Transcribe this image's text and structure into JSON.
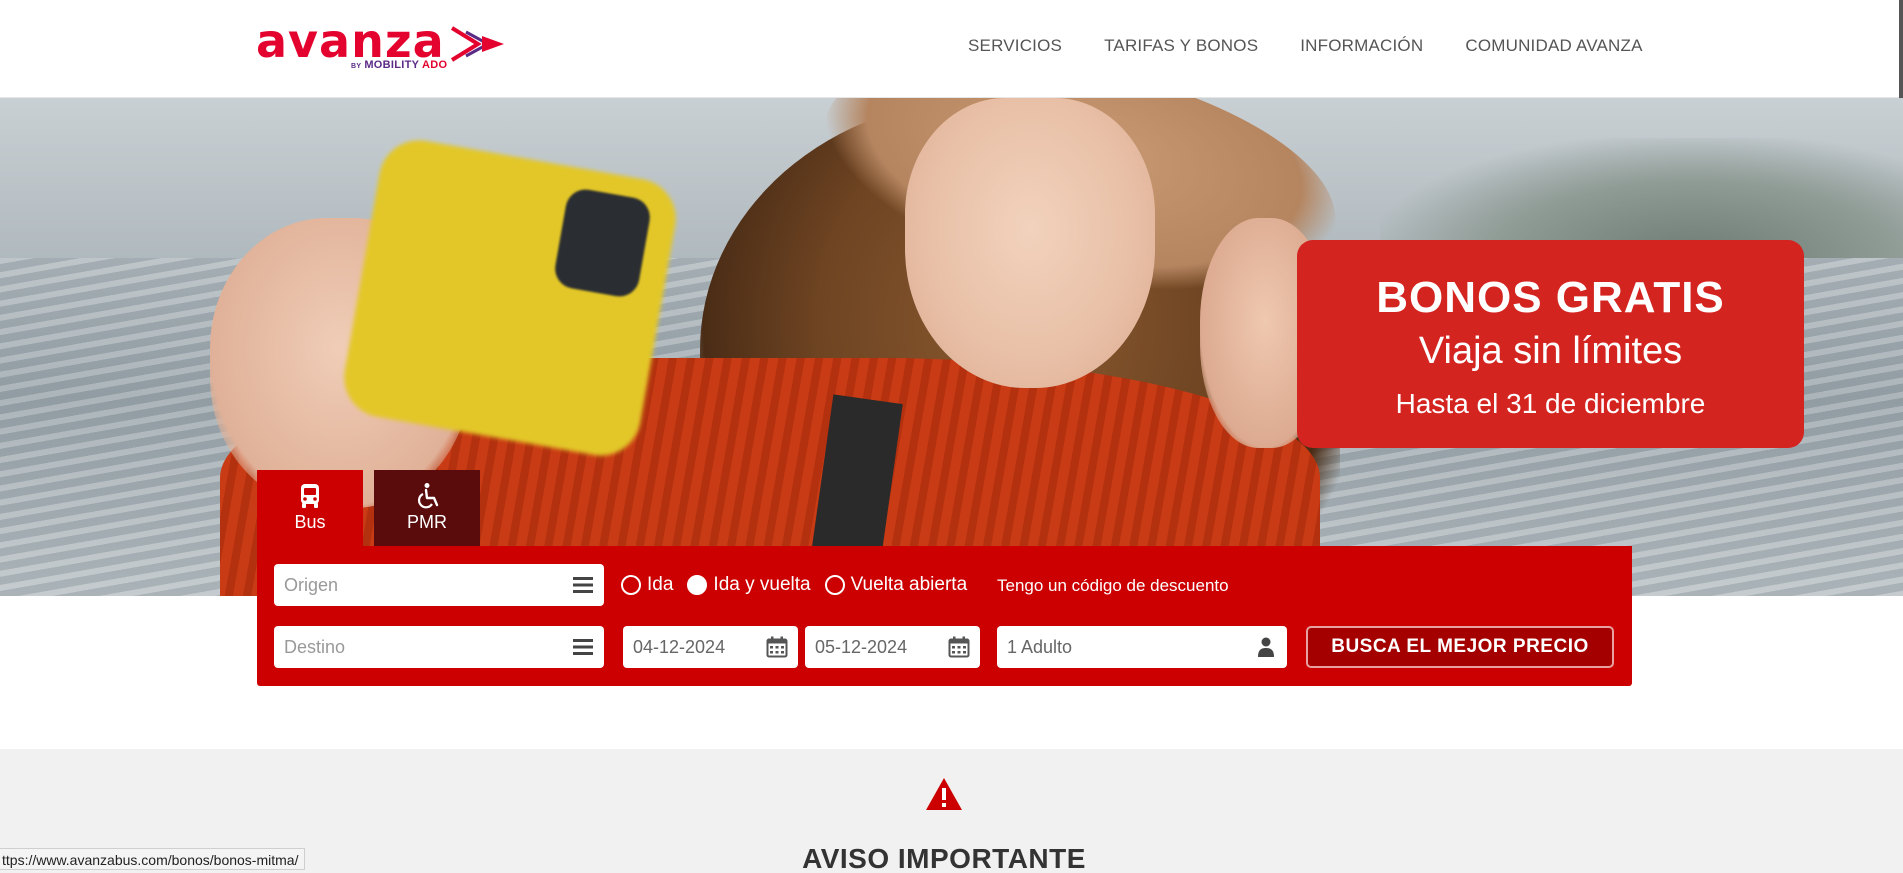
{
  "header": {
    "logo_text": "avanza",
    "logo_sub_by": "BY",
    "logo_sub_brand": "MOBILITY",
    "logo_sub_ado": "ADO",
    "nav": [
      "SERVICIOS",
      "TARIFAS Y BONOS",
      "INFORMACIÓN",
      "COMUNIDAD AVANZA"
    ]
  },
  "hero": {
    "promo_title": "BONOS GRATIS",
    "promo_subtitle": "Viaja sin límites",
    "promo_date": "Hasta el 31 de diciembre"
  },
  "tabs": [
    {
      "label": "Bus",
      "icon": "bus-icon",
      "active": true
    },
    {
      "label": "PMR",
      "icon": "wheelchair-icon",
      "active": false
    }
  ],
  "search": {
    "origen_placeholder": "Origen",
    "destino_placeholder": "Destino",
    "trip_types": [
      "Ida",
      "Ida y vuelta",
      "Vuelta abierta"
    ],
    "trip_selected": "Ida y vuelta",
    "discount_link": "Tengo un código de descuento",
    "date_ida": "04-12-2024",
    "date_vuelta": "05-12-2024",
    "passengers": "1 Adulto",
    "submit_label": "BUSCA EL MEJOR PRECIO"
  },
  "notice": {
    "title": "AVISO IMPORTANTE",
    "icon": "warning-icon"
  },
  "status_bar": {
    "url": "ttps://www.avanzabus.com/bonos/bonos-mitma/"
  },
  "colors": {
    "brand_red": "#cc0000",
    "promo_red": "#d42420",
    "dark_tab": "#5a0c0c",
    "logo_purple": "#5b2a86"
  }
}
